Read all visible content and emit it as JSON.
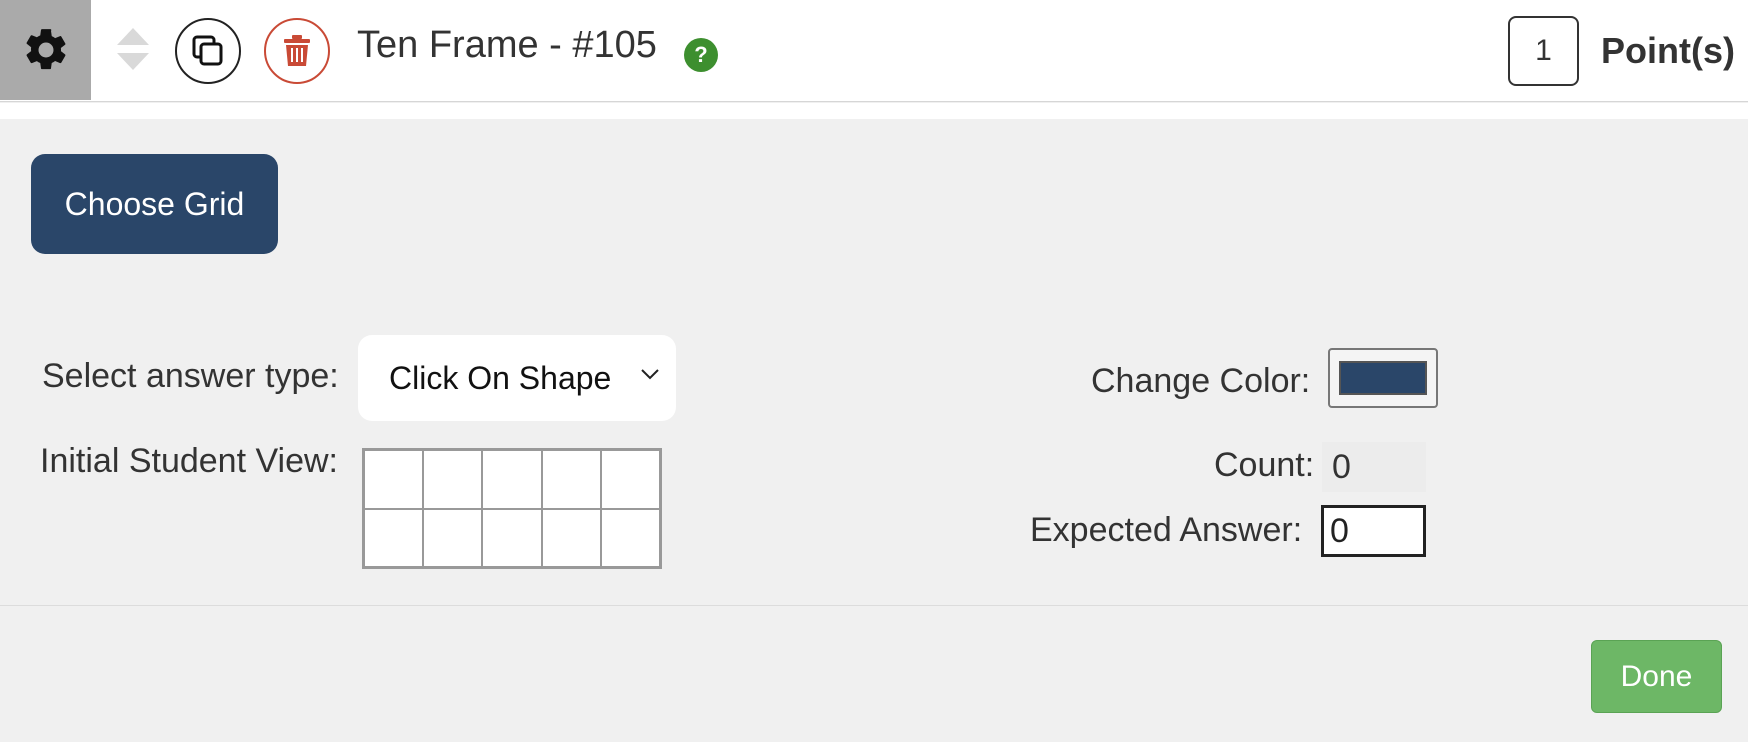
{
  "header": {
    "title": "Ten Frame - #105",
    "help_glyph": "?",
    "points_value": "1",
    "points_label": "Point(s)",
    "icons": [
      "gear-icon",
      "reorder-icon",
      "copy-icon",
      "trash-icon",
      "help-icon"
    ],
    "colors": {
      "gear_bg": "#aaaaaa",
      "trash": "#c94a36",
      "help": "#3d8f2f"
    }
  },
  "editor": {
    "choose_grid_label": "Choose Grid",
    "answer_type_label": "Select answer type:",
    "answer_type_value": "Click On Shape",
    "initial_view_label": "Initial Student View:",
    "grid": {
      "rows": 2,
      "cols": 5
    },
    "change_color_label": "Change Color:",
    "selected_color": "#2a4669",
    "count_label": "Count:",
    "count_value": "0",
    "expected_answer_label": "Expected Answer:",
    "expected_answer_value": "0"
  },
  "footer": {
    "done_label": "Done",
    "done_color": "#6db766"
  }
}
